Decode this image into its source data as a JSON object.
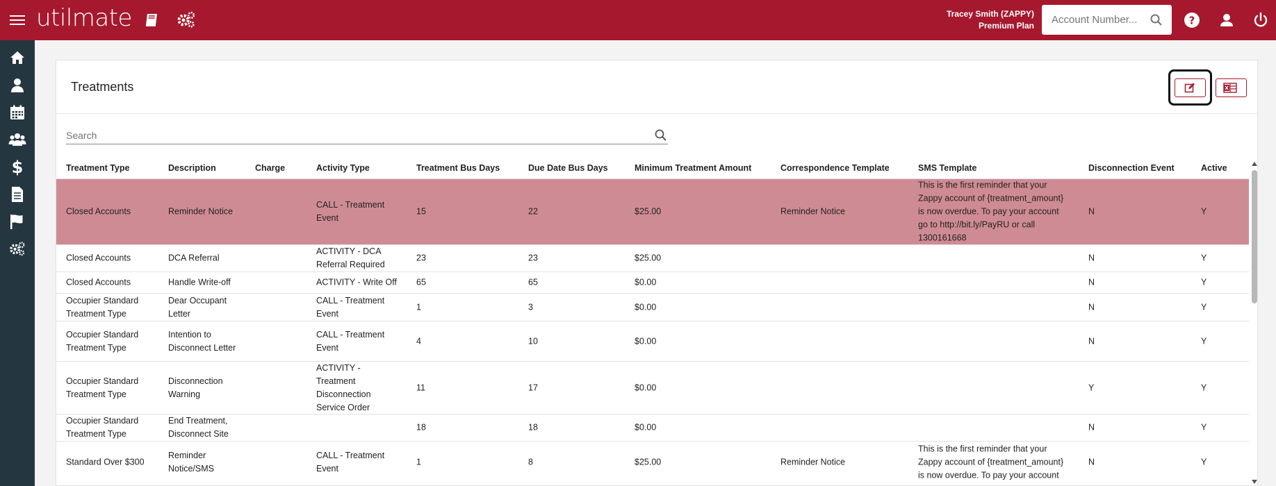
{
  "app": {
    "logo": "utilmate",
    "user_name": "Tracey Smith (ZAPPY)",
    "user_plan": "Premium Plan",
    "account_search_placeholder": "Account Number..."
  },
  "page": {
    "title": "Treatments",
    "search_placeholder": "Search"
  },
  "table": {
    "headers": {
      "treatment_type": "Treatment Type",
      "description": "Description",
      "charge": "Charge",
      "activity_type": "Activity Type",
      "treatment_bus_days": "Treatment Bus Days",
      "due_date_bus_days": "Due Date Bus Days",
      "min_treatment_amount": "Minimum Treatment Amount",
      "correspondence_template": "Correspondence Template",
      "sms_template": "SMS Template",
      "disconnection_event": "Disconnection Event",
      "active": "Active"
    },
    "rows": [
      {
        "treatment_type": "Closed Accounts",
        "description": "Reminder Notice",
        "charge": "",
        "activity_type": "CALL - Treatment Event",
        "treatment_bus_days": "15",
        "due_date_bus_days": "22",
        "min_treatment_amount": "$25.00",
        "correspondence_template": "Reminder Notice",
        "sms_template": "This is the first reminder that your Zappy account of {treatment_amount} is now overdue. To pay your account go to http://bit.ly/PayRU or call 1300161668",
        "disconnection_event": "N",
        "active": "Y",
        "selected": true
      },
      {
        "treatment_type": "Closed Accounts",
        "description": "DCA Referral",
        "charge": "",
        "activity_type": "ACTIVITY - DCA Referral Required",
        "treatment_bus_days": "23",
        "due_date_bus_days": "23",
        "min_treatment_amount": "$25.00",
        "correspondence_template": "",
        "sms_template": "",
        "disconnection_event": "N",
        "active": "Y"
      },
      {
        "treatment_type": "Closed Accounts",
        "description": "Handle Write-off",
        "charge": "",
        "activity_type": "ACTIVITY - Write Off",
        "treatment_bus_days": "65",
        "due_date_bus_days": "65",
        "min_treatment_amount": "$0.00",
        "correspondence_template": "",
        "sms_template": "",
        "disconnection_event": "N",
        "active": "Y"
      },
      {
        "treatment_type": "Occupier Standard Treatment Type",
        "description": "Dear Occupant Letter",
        "charge": "",
        "activity_type": "CALL - Treatment Event",
        "treatment_bus_days": "1",
        "due_date_bus_days": "3",
        "min_treatment_amount": "$0.00",
        "correspondence_template": "",
        "sms_template": "",
        "disconnection_event": "N",
        "active": "Y"
      },
      {
        "treatment_type": "Occupier Standard Treatment Type",
        "description": "Intention to Disconnect Letter",
        "charge": "",
        "activity_type": "CALL - Treatment Event",
        "treatment_bus_days": "4",
        "due_date_bus_days": "10",
        "min_treatment_amount": "$0.00",
        "correspondence_template": "",
        "sms_template": "",
        "disconnection_event": "N",
        "active": "Y"
      },
      {
        "treatment_type": "Occupier Standard Treatment Type",
        "description": "Disconnection Warning",
        "charge": "",
        "activity_type": "ACTIVITY - Treatment Disconnection Service Order",
        "treatment_bus_days": "11",
        "due_date_bus_days": "17",
        "min_treatment_amount": "$0.00",
        "correspondence_template": "",
        "sms_template": "",
        "disconnection_event": "Y",
        "active": "Y"
      },
      {
        "treatment_type": "Occupier Standard Treatment Type",
        "description": "End Treatment, Disconnect Site",
        "charge": "",
        "activity_type": "",
        "treatment_bus_days": "18",
        "due_date_bus_days": "18",
        "min_treatment_amount": "$0.00",
        "correspondence_template": "",
        "sms_template": "",
        "disconnection_event": "N",
        "active": "Y"
      },
      {
        "treatment_type": "Standard Over $300",
        "description": "Reminder Notice/SMS",
        "charge": "",
        "activity_type": "CALL - Treatment Event",
        "treatment_bus_days": "1",
        "due_date_bus_days": "8",
        "min_treatment_amount": "$25.00",
        "correspondence_template": "Reminder Notice",
        "sms_template": "This is the first reminder that your Zappy account of {treatment_amount} is now overdue. To pay your account",
        "disconnection_event": "N",
        "active": "Y"
      }
    ]
  },
  "colors": {
    "brand": "#a5182e",
    "sidebar": "#24363f",
    "selected_row": "#cf8b94"
  },
  "icons": {
    "topbar": [
      "menu-icon",
      "book-icon",
      "cogs-icon",
      "search-icon",
      "help-icon",
      "user-icon",
      "power-icon"
    ],
    "sidebar": [
      "home-icon",
      "person-icon",
      "calendar-icon",
      "users-icon",
      "dollar-icon",
      "document-icon",
      "flag-icon",
      "cogs-icon"
    ],
    "header_buttons": [
      "edit-icon",
      "excel-icon"
    ]
  }
}
